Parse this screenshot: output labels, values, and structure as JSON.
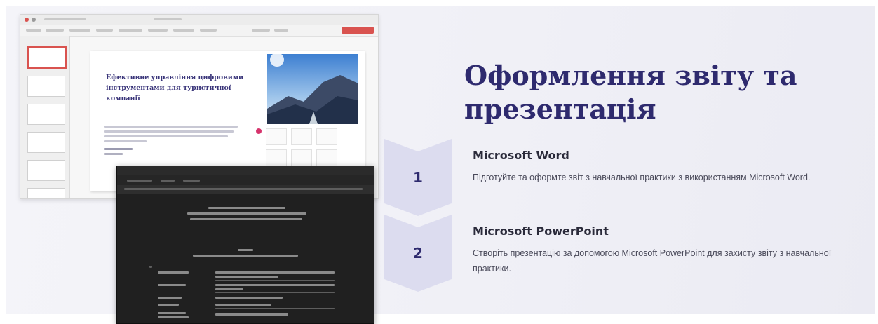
{
  "slide": {
    "title": "Оформлення звіту та презентація",
    "accent_color": "#2e2a6e",
    "steps": [
      {
        "number": "1",
        "title": "Microsoft Word",
        "description": "Підготуйте та оформте звіт з навчальної практики з використанням Microsoft Word."
      },
      {
        "number": "2",
        "title": "Microsoft PowerPoint",
        "description": "Створіть презентацію за допомогою Microsoft PowerPoint для захисту звіту з навчальної практики."
      }
    ]
  },
  "screenshot": {
    "powerpoint_slide_title": "Ефективне управління цифровими інструментами для туристичної компанії"
  }
}
